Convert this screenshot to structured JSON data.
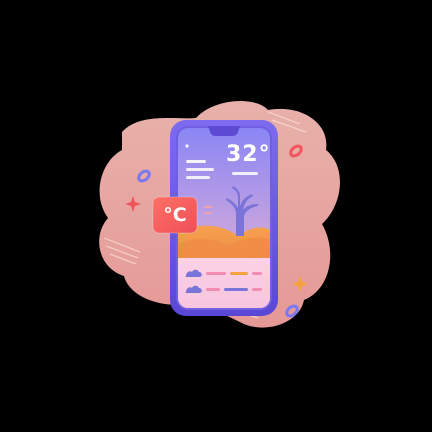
{
  "weather_card": {
    "temperature": "32°",
    "unit_badge": "°C"
  },
  "icons": {
    "phone": "smartphone-icon",
    "tree": "bare-tree-icon",
    "cloud": "cloud-icon",
    "sparkle": "sparkle-icon",
    "ring": "ring-icon"
  },
  "colors": {
    "background": "#000000",
    "blob": "#fbb3ad",
    "phone_frame": "#6c5be0",
    "sky_top": "#8c86f5",
    "sky_bottom": "#f0a9b4",
    "dune": "#f39a4d",
    "badge": "#f4605f",
    "forecast_panel": "#fbe3ef",
    "sparkle_red": "#f0555c",
    "sparkle_orange": "#f5a23a",
    "ring_blue": "#7a78f2"
  }
}
